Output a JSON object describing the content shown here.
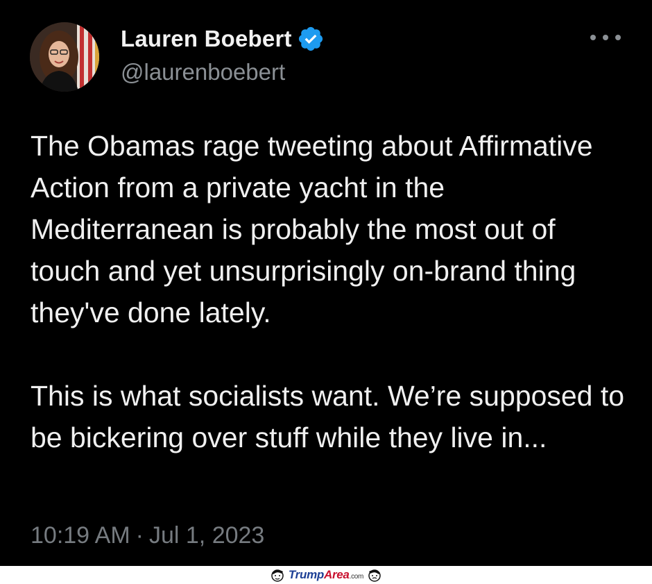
{
  "tweet": {
    "author": {
      "display_name": "Lauren Boebert",
      "handle": "@laurenboebert",
      "verified": true,
      "avatar_icon": "profile-photo"
    },
    "more_icon": "more-horizontal-icon",
    "paragraphs": [
      "The Obamas rage tweeting about Affirmative Action from a private yacht in the Mediterranean is probably the most out of touch and yet unsurprisingly on-brand thing they've done lately.",
      "This is what socialists want. We’re supposed to be bickering over stuff while they live in..."
    ],
    "time": "10:19 AM",
    "separator": "·",
    "date": "Jul 1, 2023"
  },
  "watermark": {
    "part1": "Trump",
    "part2": "Area",
    "part3": ".com"
  },
  "colors": {
    "background": "#000000",
    "verified": "#1d9bf0",
    "secondary_text": "#8b9095"
  }
}
